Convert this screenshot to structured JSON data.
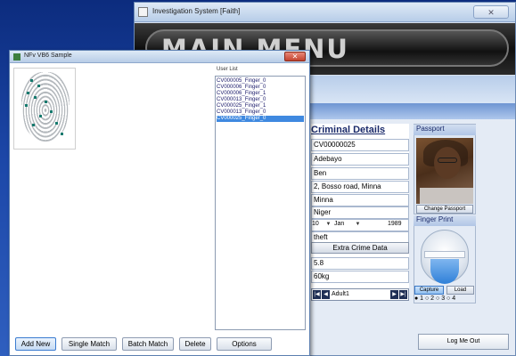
{
  "main_window": {
    "title": "Investigation System [Faith]",
    "banner_title": "MAIN MENU",
    "close_glyph": "✕"
  },
  "criminal_details": {
    "heading": "Criminal Details",
    "id": "CV00000025",
    "surname": "Adebayo",
    "first_name": "Ben",
    "address": "2, Bosso road, Minna",
    "city": "Minna",
    "state": "Niger",
    "dob_day": "10",
    "dob_month": "Jan",
    "dob_year": "1989",
    "crime": "theft",
    "extra_crime_label": "Extra Crime Data",
    "height": "5.8",
    "weight": "60kg",
    "nav_record": "Adult1"
  },
  "passport": {
    "heading": "Passport",
    "change_button": "Change Passport"
  },
  "finger_print": {
    "heading": "Finger Print",
    "capture_button": "Capture",
    "load_button": "Load",
    "radios": "● 1 ○ 2 ○ 3 ○ 4"
  },
  "logout_button": "Log Me Out",
  "sample_window": {
    "title": "NFv VB6 Sample",
    "close_glyph": "✕",
    "user_list_label": "User List",
    "user_list": [
      "CV000005_Finger_0",
      "CV000006_Finger_0",
      "CV000006_Finger_1",
      "CV000013_Finger_0",
      "CV000025_Finger_1",
      "CV000013_Finger_0",
      "CV000025_Finger_0"
    ],
    "selected_index": 6,
    "buttons": {
      "add_new": "Add New",
      "single_match": "Single Match",
      "batch_match": "Batch Match",
      "delete": "Delete",
      "options": "Options"
    }
  },
  "colors": {
    "desktop": "#1c47a8",
    "selection": "#3f89e0",
    "details_heading": "#1a2a6a"
  }
}
